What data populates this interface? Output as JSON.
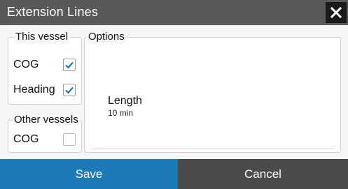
{
  "dialog": {
    "title": "Extension Lines",
    "close_icon": "close-icon"
  },
  "this_vessel": {
    "legend": "This vessel",
    "items": [
      {
        "label": "COG",
        "checked": true
      },
      {
        "label": "Heading",
        "checked": true
      }
    ]
  },
  "other_vessels": {
    "legend": "Other vessels",
    "items": [
      {
        "label": "COG",
        "checked": false
      }
    ]
  },
  "options": {
    "legend": "Options",
    "length": {
      "label": "Length",
      "value": "10 min"
    }
  },
  "buttons": {
    "save": "Save",
    "cancel": "Cancel"
  },
  "colors": {
    "titlebar": "#595959",
    "save": "#1c7bb6",
    "cancel": "#4a4a4a",
    "check": "#1c7bb6"
  }
}
